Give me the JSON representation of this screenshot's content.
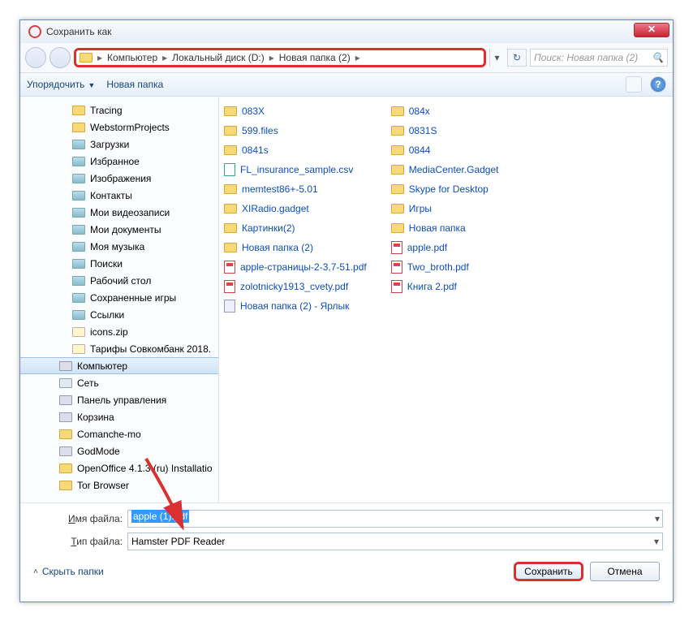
{
  "window": {
    "title": "Сохранить как"
  },
  "breadcrumb": {
    "items": [
      "Компьютер",
      "Локальный диск (D:)",
      "Новая папка (2)"
    ]
  },
  "search": {
    "placeholder": "Поиск: Новая папка (2)"
  },
  "toolbar": {
    "organize": "Упорядочить",
    "newfolder": "Новая папка"
  },
  "tree": [
    {
      "label": "Tracing",
      "cls": ""
    },
    {
      "label": "WebstormProjects",
      "cls": ""
    },
    {
      "label": "Загрузки",
      "cls": "sp"
    },
    {
      "label": "Избранное",
      "cls": "sp"
    },
    {
      "label": "Изображения",
      "cls": "sp"
    },
    {
      "label": "Контакты",
      "cls": "sp"
    },
    {
      "label": "Мои видеозаписи",
      "cls": "sp"
    },
    {
      "label": "Мои документы",
      "cls": "sp"
    },
    {
      "label": "Моя музыка",
      "cls": "sp"
    },
    {
      "label": "Поиски",
      "cls": "sp"
    },
    {
      "label": "Рабочий стол",
      "cls": "sp"
    },
    {
      "label": "Сохраненные игры",
      "cls": "sp"
    },
    {
      "label": "Ссылки",
      "cls": "sp"
    },
    {
      "label": "icons.zip",
      "cls": "zip"
    },
    {
      "label": "Тарифы Совкомбанк 2018.",
      "cls": "zip"
    },
    {
      "label": "Компьютер",
      "cls": "pc",
      "sel": true,
      "lvl": "l0"
    },
    {
      "label": "Сеть",
      "cls": "net",
      "lvl": "l0"
    },
    {
      "label": "Панель управления",
      "cls": "pc",
      "lvl": "l0"
    },
    {
      "label": "Корзина",
      "cls": "pc",
      "lvl": "l0"
    },
    {
      "label": "Comanche-mo",
      "cls": "",
      "lvl": "l0"
    },
    {
      "label": "GodMode",
      "cls": "pc",
      "lvl": "l0"
    },
    {
      "label": "OpenOffice 4.1.3 (ru) Installatio",
      "cls": "",
      "lvl": "l0"
    },
    {
      "label": "Tor Browser",
      "cls": "",
      "lvl": "l0"
    }
  ],
  "files_col1": [
    {
      "label": "083X",
      "icon": "folder"
    },
    {
      "label": "599.files",
      "icon": "folder"
    },
    {
      "label": "0841s",
      "icon": "folder"
    },
    {
      "label": "FL_insurance_sample.csv",
      "icon": "csv"
    },
    {
      "label": "memtest86+-5.01",
      "icon": "folder"
    },
    {
      "label": "XIRadio.gadget",
      "icon": "folder"
    },
    {
      "label": "Картинки(2)",
      "icon": "folder"
    },
    {
      "label": "Новая папка (2)",
      "icon": "folder"
    },
    {
      "label": "apple-страницы-2-3,7-51.pdf",
      "icon": "pdf"
    },
    {
      "label": "zolotnicky1913_cvety.pdf",
      "icon": "pdf"
    },
    {
      "label": "Новая папка (2) - Ярлык",
      "icon": "lnk"
    }
  ],
  "files_col2": [
    {
      "label": "084x",
      "icon": "folder"
    },
    {
      "label": "0831S",
      "icon": "folder"
    },
    {
      "label": "0844",
      "icon": "folder"
    },
    {
      "label": "MediaCenter.Gadget",
      "icon": "folder"
    },
    {
      "label": "Skype for Desktop",
      "icon": "folder"
    },
    {
      "label": "Игры",
      "icon": "folder"
    },
    {
      "label": "Новая папка",
      "icon": "folder"
    },
    {
      "label": "apple.pdf",
      "icon": "pdf"
    },
    {
      "label": "Two_broth.pdf",
      "icon": "pdf"
    },
    {
      "label": "Книга 2.pdf",
      "icon": "pdf"
    }
  ],
  "filename": {
    "label": "Имя файла:",
    "value": "apple (1).pdf"
  },
  "filetype": {
    "label": "Тип файла:",
    "value": "Hamster PDF Reader"
  },
  "footer": {
    "hidefolders": "Скрыть папки",
    "save": "Сохранить",
    "cancel": "Отмена"
  }
}
